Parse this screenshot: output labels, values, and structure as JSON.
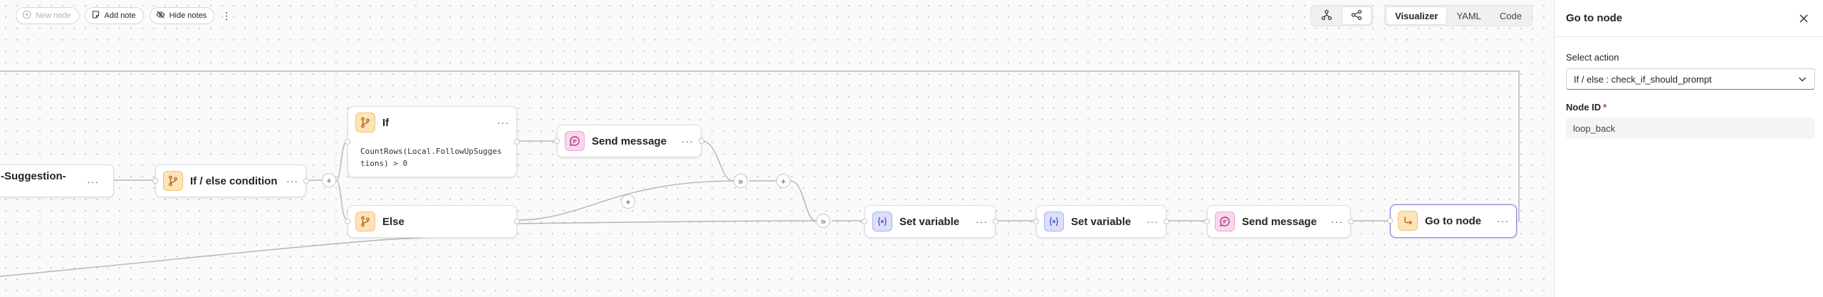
{
  "toolbar": {
    "new_node": "New node",
    "add_note": "Add note",
    "hide_notes": "Hide notes",
    "more": "⋮"
  },
  "view_toggle": {
    "icons": [
      "hierarchy-icon",
      "share-nodes-icon"
    ],
    "tabs": [
      "Visualizer",
      "YAML",
      "Code"
    ],
    "active_tab": "Visualizer"
  },
  "nodes": {
    "partial_topic": {
      "title": "-Suggestion-",
      "more": "···"
    },
    "if_else": {
      "title": "If / else condition",
      "more": "···"
    },
    "if_branch": {
      "title": "If",
      "more": "···",
      "condition": "CountRows(Local.FollowUpSuggestions) > 0"
    },
    "else_branch": {
      "title": "Else",
      "more": "···"
    },
    "send_message_1": {
      "title": "Send message",
      "more": "···"
    },
    "set_variable_1": {
      "title": "Set variable",
      "more": "···"
    },
    "set_variable_2": {
      "title": "Set variable",
      "more": "···"
    },
    "send_message_2": {
      "title": "Send message",
      "more": "···"
    },
    "go_to_node": {
      "title": "Go to node",
      "more": "···"
    }
  },
  "edge_controls": {
    "add": "+",
    "merge": "»"
  },
  "panel": {
    "title": "Go to node",
    "select_action_label": "Select action",
    "select_action_value": "If / else : check_if_should_prompt",
    "node_id_label": "Node ID",
    "node_id_required": "*",
    "node_id_value": "loop_back"
  },
  "colors": {
    "canvas_bg": "#fafafa",
    "condition_icon": "#fde3b8",
    "message_icon": "#f9d6ec",
    "variable_icon": "#dcdffa",
    "selected_border": "#8b86d8"
  }
}
